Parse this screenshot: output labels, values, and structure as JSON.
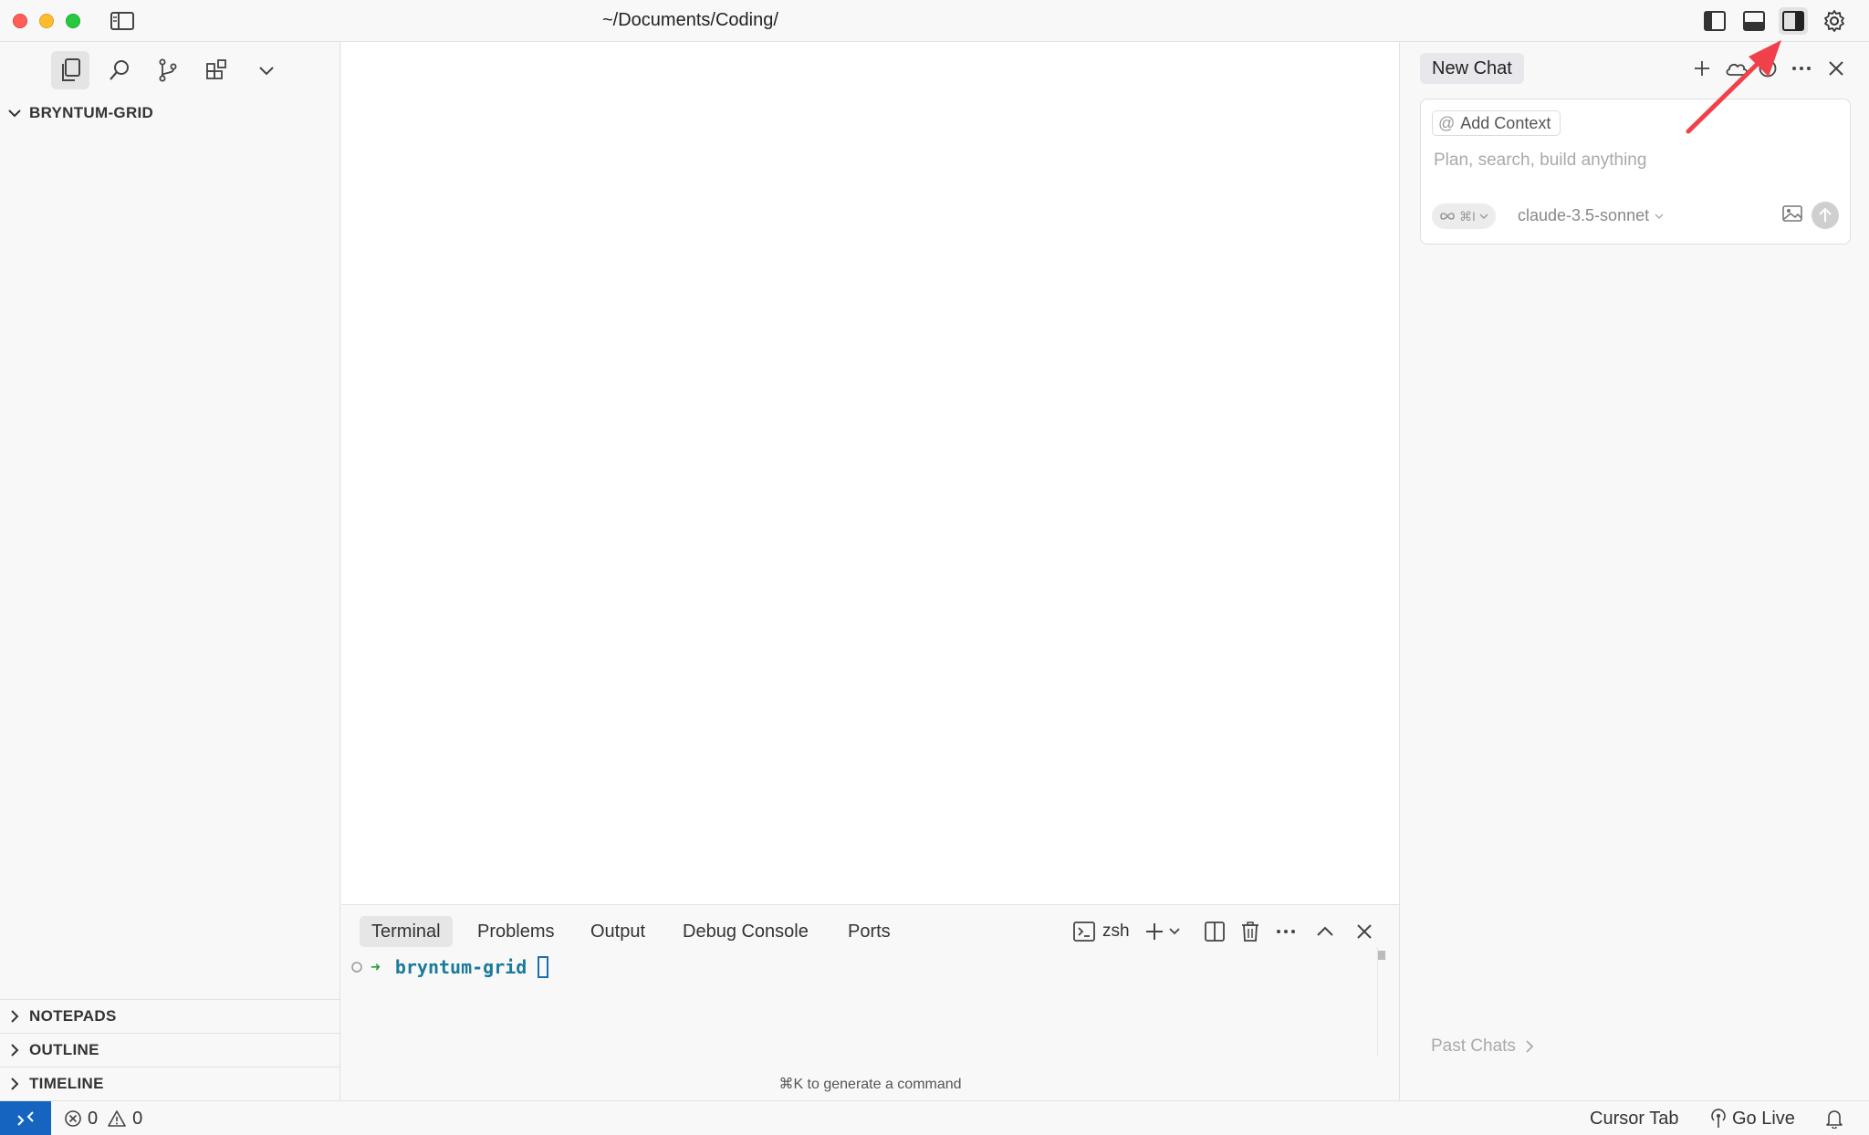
{
  "window": {
    "title": "~/Documents/Coding/"
  },
  "explorer": {
    "root_folder": "BRYNTUM-GRID",
    "bottom_sections": [
      "NOTEPADS",
      "OUTLINE",
      "TIMELINE"
    ]
  },
  "panel": {
    "tabs": [
      "Terminal",
      "Problems",
      "Output",
      "Debug Console",
      "Ports"
    ],
    "shell_label": "zsh",
    "prompt_arrow": "➜",
    "prompt_dir": "bryntum-grid",
    "hint": "⌘K to generate a command"
  },
  "chat": {
    "tab_label": "New Chat",
    "add_context_label": "Add Context",
    "input_placeholder": "Plan, search, build anything",
    "mode_shortcut": "⌘I",
    "model": "claude-3.5-sonnet",
    "past_chats_label": "Past Chats"
  },
  "status": {
    "errors": "0",
    "warnings": "0",
    "cursor_tab": "Cursor Tab",
    "go_live": "Go Live"
  },
  "colors": {
    "remote_bg": "#1565c0",
    "annotation_arrow": "#f0414b",
    "terminal_dir": "#1a7a9a"
  }
}
